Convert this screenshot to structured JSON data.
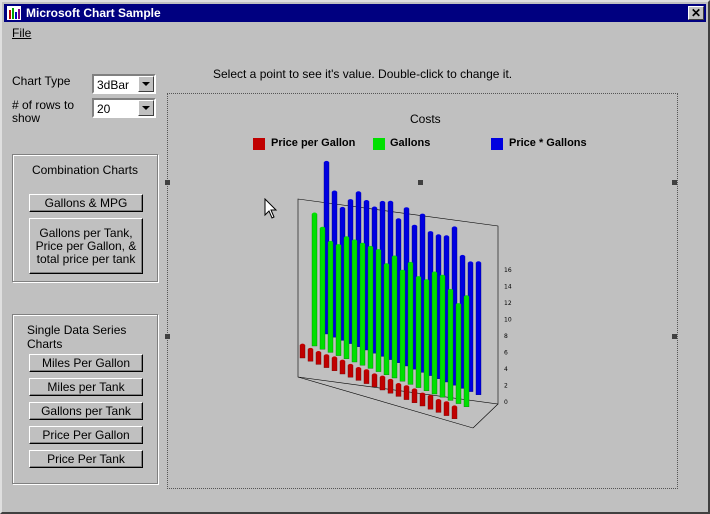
{
  "window": {
    "title": "Microsoft Chart Sample",
    "close_glyph": "✕"
  },
  "menu": {
    "file": "File"
  },
  "controls": {
    "chart_type_label": "Chart Type",
    "chart_type_value": "3dBar",
    "rows_label": "# of rows to show",
    "rows_value": "20"
  },
  "combination": {
    "title": "Combination Charts",
    "buttons": [
      "Gallons & MPG",
      "Gallons per Tank, Price per Gallon, & total price per tank"
    ]
  },
  "single": {
    "title": "Single Data Series Charts",
    "buttons": [
      "Miles Per Gallon",
      "Miles per Tank",
      "Gallons per Tank",
      "Price Per Gallon",
      "Price Per Tank"
    ]
  },
  "hint": "Select a point to see it's value. Double-click to change it.",
  "colors": {
    "price": "#c00000",
    "gallons": "#00e000",
    "total": "#0000e0"
  },
  "chart_data": {
    "type": "bar",
    "title": "Costs",
    "legend": [
      "Price per Gallon",
      "Gallons",
      "Price * Gallons"
    ],
    "yticks_right": [
      "0",
      "2",
      "4",
      "6",
      "8",
      "10",
      "12",
      "14",
      "16"
    ],
    "series": [
      {
        "name": "Price per Gallon",
        "values": [
          1.3,
          1.2,
          1.2,
          1.2,
          1.3,
          1.3,
          1.2,
          1.2,
          1.3,
          1.2,
          1.3,
          1.3,
          1.2,
          1.3,
          1.3,
          1.2,
          1.3,
          1.2,
          1.3,
          1.2
        ]
      },
      {
        "name": "Gallons",
        "values": [
          12,
          11,
          10,
          10,
          11,
          11,
          11,
          11,
          11,
          10,
          11,
          10,
          11,
          10,
          10,
          11,
          11,
          10,
          9,
          10
        ]
      },
      {
        "name": "Price * Gallons",
        "values": [
          15.6,
          13.2,
          12,
          13,
          14,
          13.5,
          13.2,
          14,
          14.3,
          13,
          14.3,
          13,
          14.3,
          13,
          13,
          13.2,
          14.3,
          12,
          11.7,
          12
        ]
      }
    ]
  }
}
